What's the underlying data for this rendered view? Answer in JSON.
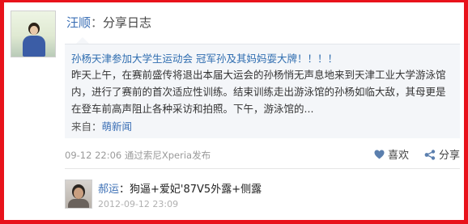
{
  "post": {
    "author": "汪顺",
    "separator": "：",
    "action": "分享日志",
    "title": "孙杨天津参加大学生运动会 冠军孙及其妈妈耍大牌！！！！",
    "body": "昨天上午，在赛前盛传将退出本届大运会的孙杨悄无声息地来到天津工业大学游泳馆内，进行了赛前的首次适应性训练。结束训练走出游泳馆的孙杨如临大敌，其母更是在登车前高声阻止各种采访和拍照。下午，游泳馆的...",
    "source_label": "来自：",
    "source_name": "萌新闻",
    "meta": "09-12 22:06  通过索尼Xperia发布",
    "like_label": "喜欢",
    "share_label": "分享",
    "like_icon": "heart-icon",
    "share_icon": "share-icon"
  },
  "comment": {
    "author": "郝运",
    "separator": "：",
    "text": "狗逼+爱妃'87V5外露+侧露",
    "time": "2012-09-12 23:09"
  },
  "colors": {
    "frame": "#e8121b",
    "link": "#3b6fb5",
    "quote_bg": "#f4f6f9"
  }
}
